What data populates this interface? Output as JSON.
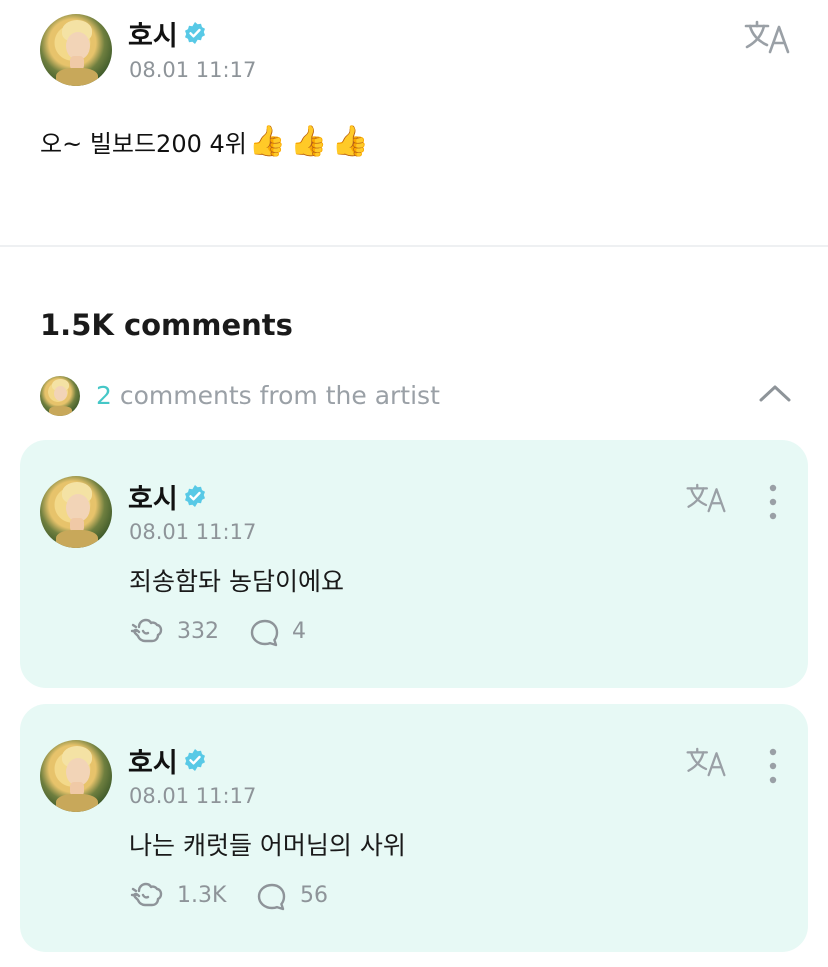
{
  "post": {
    "author": "호시",
    "time": "08.01 11:17",
    "text": "오~ 빌보드200 4위",
    "emojis": "👍👍👍"
  },
  "comments_header": {
    "count_label": "1.5K comments",
    "artist_count": "2",
    "artist_label": "comments from the artist"
  },
  "comments": [
    {
      "author": "호시",
      "time": "08.01 11:17",
      "text": "죄송함돠 농담이에요",
      "likes": "332",
      "replies": "4"
    },
    {
      "author": "호시",
      "time": "08.01 11:17",
      "text": "나는 캐럿들 어머님의 사위",
      "likes": "1.3K",
      "replies": "56"
    }
  ],
  "colors": {
    "accent": "#45c7c7",
    "verified": "#58c9e6",
    "card_bg": "#e7f9f5",
    "muted": "#8e9499"
  },
  "icons": {
    "translate": "translate-icon",
    "more": "more-vertical-icon",
    "chevron": "chevron-up-icon",
    "like": "like-icon",
    "reply": "comment-bubble-icon",
    "verified": "verified-badge-icon"
  }
}
